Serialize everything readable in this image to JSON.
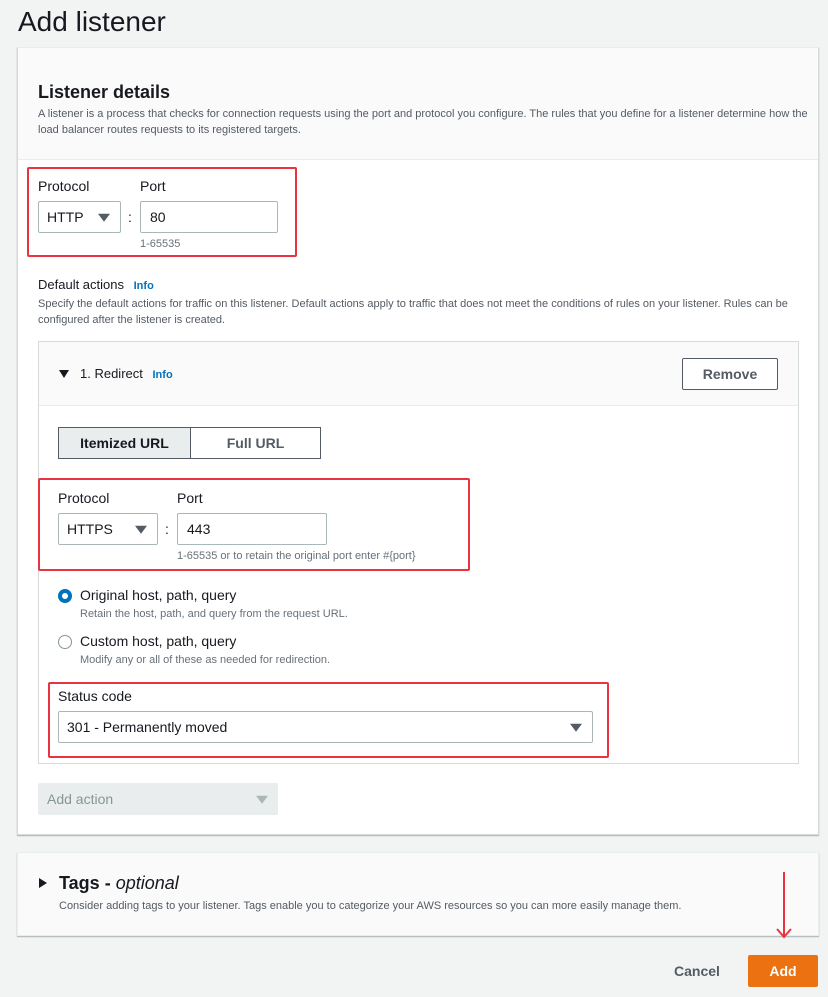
{
  "page": {
    "title": "Add listener"
  },
  "listener_details": {
    "title": "Listener details",
    "description": "A listener is a process that checks for connection requests using the port and protocol you configure. The rules that you define for a listener determine how the load balancer routes requests to its registered targets.",
    "protocol_label": "Protocol",
    "protocol_value": "HTTP",
    "port_label": "Port",
    "port_value": "80",
    "port_hint": "1-65535",
    "separator": ":"
  },
  "default_actions": {
    "title": "Default actions",
    "info_label": "Info",
    "description": "Specify the default actions for traffic on this listener. Default actions apply to traffic that does not meet the conditions of rules on your listener. Rules can be configured after the listener is created.",
    "action": {
      "title": "1. Redirect",
      "info_label": "Info",
      "remove_label": "Remove",
      "url_modes": [
        {
          "label": "Itemized URL",
          "active": true
        },
        {
          "label": "Full URL",
          "active": false
        }
      ],
      "protocol_label": "Protocol",
      "protocol_value": "HTTPS",
      "port_label": "Port",
      "port_value": "443",
      "port_hint": "1-65535 or to retain the original port enter #{port}",
      "separator": ":",
      "host_options": [
        {
          "label": "Original host, path, query",
          "description": "Retain the host, path, and query from the request URL.",
          "checked": true
        },
        {
          "label": "Custom host, path, query",
          "description": "Modify any or all of these as needed for redirection.",
          "checked": false
        }
      ],
      "status_code_label": "Status code",
      "status_code_value": "301 - Permanently moved"
    },
    "add_action_placeholder": "Add action"
  },
  "tags": {
    "title": "Tags",
    "title_suffix": " - ",
    "optional_label": "optional",
    "description": "Consider adding tags to your listener. Tags enable you to categorize your AWS resources so you can more easily manage them."
  },
  "footer": {
    "cancel_label": "Cancel",
    "add_label": "Add"
  },
  "colors": {
    "primary": "#ec7211",
    "link": "#0073bb",
    "annotation": "#e8343f"
  }
}
